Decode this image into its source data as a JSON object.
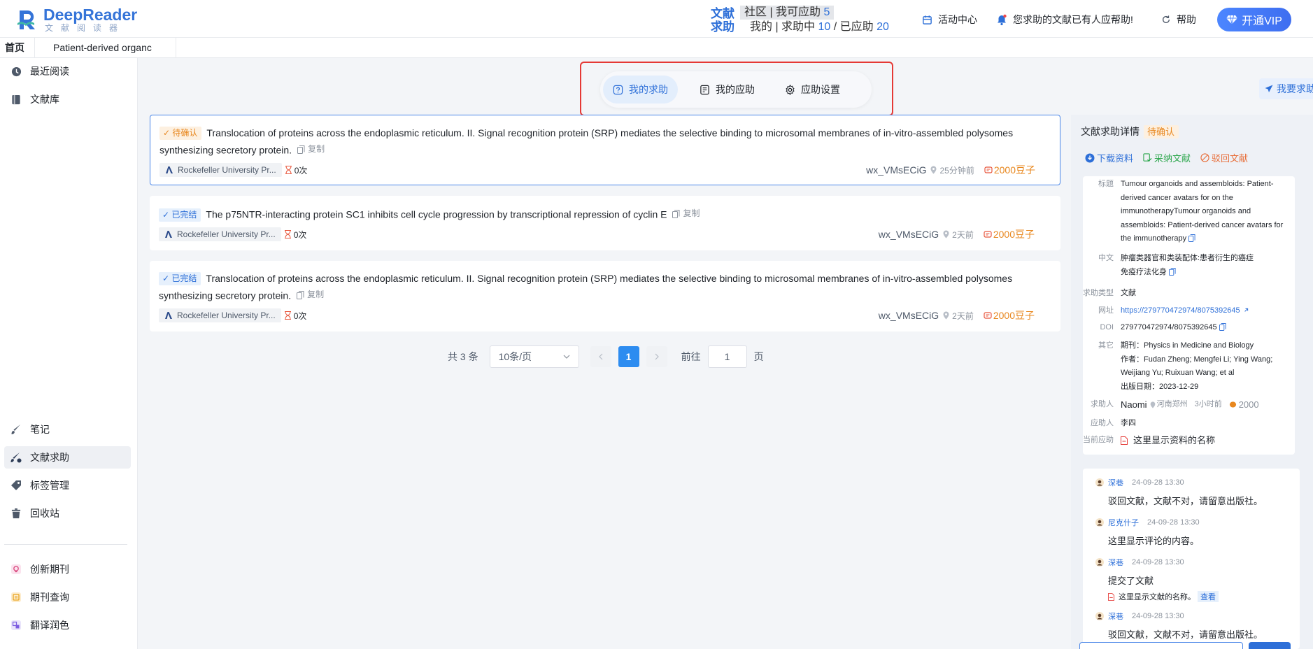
{
  "header": {
    "logo_name": "DeepReader",
    "logo_sub": "文献阅读器",
    "help_tag_1": "文献",
    "help_tag_2": "求助",
    "community_label": "社区 | 我可应助",
    "community_count": "5",
    "mine_label": "我的 | 求助中",
    "mine_pending": "10",
    "mine_sep": "/",
    "mine_done_label": "已应助",
    "mine_done": "20",
    "activity": "活动中心",
    "notification": "您求助的文献已有人应帮助!",
    "help": "帮助",
    "vip": "开通VIP"
  },
  "tabs": {
    "home": "首页",
    "doc": "Patient-derived organc"
  },
  "sidebar": {
    "recent": "最近阅读",
    "library": "文献库",
    "notes": "笔记",
    "doc_help": "文献求助",
    "tags": "标签管理",
    "trash": "回收站",
    "new_journal": "创新期刊",
    "journal_query": "期刊查询",
    "translate": "翻译润色"
  },
  "segments": {
    "my_requests": "我的求助",
    "my_responses": "我的应助",
    "settings": "应助设置"
  },
  "ask_button": "我要求助",
  "copy_label": "复制",
  "cards": [
    {
      "status": "待确认",
      "title": "Translocation of proteins across the endoplasmic reticulum. II. Signal recognition protein (SRP) mediates the selective binding to microsomal membranes of in-vitro-assembled polysomes synthesizing secretory protein.",
      "publisher": "Rockefeller University Pr...",
      "count": "0次",
      "user": "wx_VMsECiG",
      "time": "25分钟前",
      "beans": "2000豆子"
    },
    {
      "status": "已完结",
      "title": "The p75NTR-interacting protein SC1 inhibits cell cycle progression by transcriptional repression of cyclin E",
      "publisher": "Rockefeller University Pr...",
      "count": "0次",
      "user": "wx_VMsECiG",
      "time": "2天前",
      "beans": "2000豆子"
    },
    {
      "status": "已完结",
      "title": "Translocation of proteins across the endoplasmic reticulum. II. Signal recognition protein (SRP) mediates the selective binding to microsomal membranes of in-vitro-assembled polysomes synthesizing secretory protein.",
      "publisher": "Rockefeller University Pr...",
      "count": "0次",
      "user": "wx_VMsECiG",
      "time": "2天前",
      "beans": "2000豆子"
    }
  ],
  "pager": {
    "total": "共 3 条",
    "page_size": "10条/页",
    "current": "1",
    "goto_label": "前往",
    "goto_value": "1",
    "page_unit": "页"
  },
  "detail": {
    "title": "文献求助详情",
    "status": "待确认",
    "download": "下载资料",
    "accept": "采纳文献",
    "reject": "驳回文献",
    "rows": {
      "title_key": "标题",
      "title_val": "Tumour organoids and assembloids: Patient-derived cancer avatars for on the immunotherapyTumour organoids and assembloids: Patient-derived cancer avatars for the immunotherapy",
      "cn_key": "中文",
      "cn_val": "肿瘤类器官和类装配体:患者衍生的癌症免疫疗法化身",
      "type_key": "求助类型",
      "type_val": "文献",
      "url_key": "网址",
      "url_val": "https://279770472974/8075392645",
      "doi_key": "DOI",
      "doi_val": "279770472974/8075392645",
      "other_key": "其它",
      "journal": "期刊：Physics in Medicine and Biology",
      "authors": "作者：Fudan Zheng; Mengfei Li; Ying Wang; Weijiang Yu; Ruixuan Wang; et al",
      "date": "出版日期：2023-12-29",
      "requester_key": "求助人",
      "requester": "Naomi",
      "location": "河南郑州",
      "req_time": "3小时前",
      "req_beans": "2000",
      "responder_key": "应助人",
      "responder": "李四",
      "current_key": "当前应助",
      "current": "这里显示资料的名称"
    }
  },
  "comments": [
    {
      "name": "深巷",
      "time": "24-09-28 13:30",
      "body": "驳回文献，文献不对，请留意出版社。"
    },
    {
      "name": "尼克什子",
      "time": "24-09-28 13:30",
      "body": "这里显示评论的内容。"
    },
    {
      "name": "深巷",
      "time": "24-09-28 13:30",
      "body": "提交了文献",
      "file": "这里显示文献的名称。",
      "view": "查看"
    },
    {
      "name": "深巷",
      "time": "24-09-28 13:30",
      "body": "驳回文献，文献不对，请留意出版社。"
    }
  ],
  "colors": {
    "primary": "#2d6fd8",
    "pending": "#e8871e",
    "accept": "#2fa84f",
    "reject": "#e8703c",
    "highlight_box": "#e53935"
  }
}
